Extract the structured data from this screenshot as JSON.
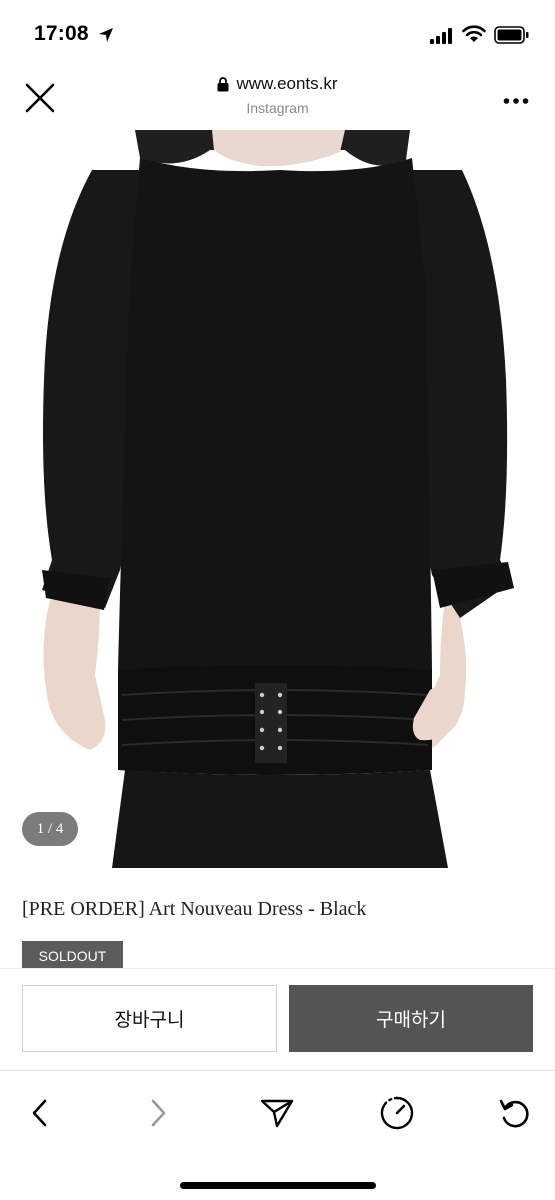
{
  "status_bar": {
    "time": "17:08",
    "icons": [
      "location-arrow-icon",
      "signal-bars-icon",
      "wifi-icon",
      "battery-icon"
    ]
  },
  "browser": {
    "url": "www.eonts.kr",
    "source": "Instagram",
    "icons": [
      "close-icon",
      "lock-icon",
      "more-dots-icon"
    ]
  },
  "product": {
    "image_counter": "1 / 4",
    "title": "[PRE ORDER] Art Nouveau Dress - Black",
    "badge": "SOLDOUT"
  },
  "actions": {
    "cart_label": "장바구니",
    "buy_label": "구매하기"
  },
  "toolbar": {
    "icons": [
      "back-chevron-icon",
      "forward-chevron-icon",
      "share-send-icon",
      "speedometer-icon",
      "reload-icon"
    ]
  },
  "colors": {
    "dress": "#141414",
    "buy_button": "#545454",
    "badge": "#5c5c5c",
    "counter_pill": "#7c7c7c"
  }
}
